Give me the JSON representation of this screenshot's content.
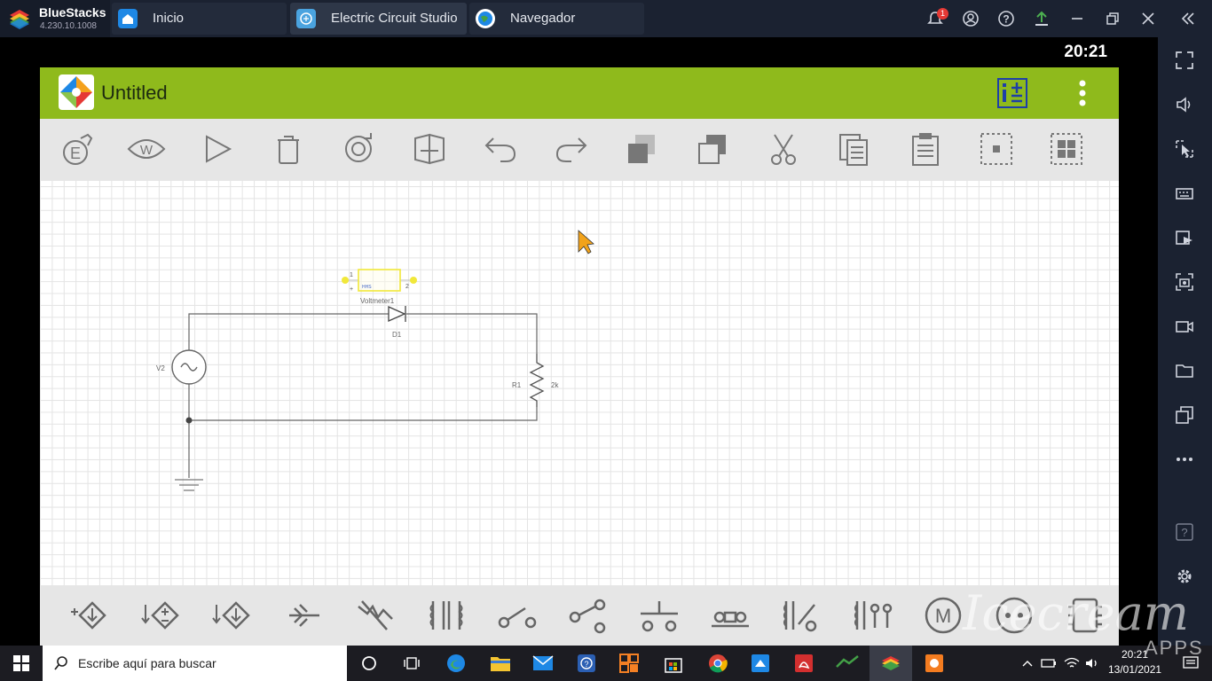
{
  "bluestacks": {
    "name": "BlueStacks",
    "version": "4.230.10.1008",
    "tabs": [
      {
        "label": "Inicio",
        "icon": "home-icon"
      },
      {
        "label": "Electric Circuit Studio",
        "icon": "circuit-app-icon"
      },
      {
        "label": "Navegador",
        "icon": "globe-icon"
      }
    ],
    "notification_count": "1",
    "top_icons": [
      "bell-icon",
      "account-icon",
      "help-icon",
      "upload-icon",
      "minimize-icon",
      "restore-icon",
      "close-icon",
      "collapse-sidebar-icon"
    ],
    "sidebar_icons": [
      "fullscreen-icon",
      "volume-icon",
      "pointer-icon",
      "keyboard-icon",
      "media-icon",
      "screenshot-icon",
      "record-icon",
      "folder-icon",
      "multi-instance-icon",
      "more-icon",
      "help-icon",
      "settings-icon"
    ]
  },
  "android": {
    "clock": "20:21"
  },
  "app": {
    "title": "Untitled",
    "actions": [
      "add-info-icon",
      "overflow-menu-icon"
    ],
    "toolbar": [
      "edit-settings-icon",
      "watch-icon",
      "run-icon",
      "delete-icon",
      "rotate-icon",
      "flip-icon",
      "undo-icon",
      "redo-icon",
      "copy-icon",
      "duplicate-icon",
      "cut-icon",
      "paste-icon",
      "clipboard-icon",
      "select-one-icon",
      "select-all-icon"
    ],
    "palette": [
      "voltage-source-icon",
      "dependent-source-icon",
      "current-source-icon",
      "zener-icon",
      "varistor-icon",
      "transformer-icon",
      "switch-spst-icon",
      "switch-spdt-icon",
      "pushbutton-icon",
      "relay-icon",
      "relay-switch-icon",
      "relay-switch-2-icon",
      "motor-icon",
      "meter-icon",
      "chip-icon"
    ]
  },
  "circuit": {
    "voltmeter_label": "Voltmeter1",
    "voltmeter_pin1": "1",
    "voltmeter_pin2": "2",
    "voltmeter_plus": "+",
    "voltmeter_value": "HHS",
    "diode_label": "D1",
    "source_label": "V2",
    "resistor_label": "R1",
    "resistor_value": "2k"
  },
  "taskbar": {
    "search_placeholder": "Escribe aquí para buscar",
    "time": "20:21",
    "date": "13/01/2021",
    "apps": [
      "task-view-icon",
      "edge-icon",
      "file-explorer-icon",
      "mail-icon",
      "help-app-icon",
      "office-icon",
      "store-icon",
      "chrome-icon",
      "paint-icon",
      "acrobat-icon",
      "gaming-icon",
      "bluestacks-icon",
      "icecream-icon"
    ]
  },
  "watermark": {
    "brand": "Icecream",
    "sub": "APPS"
  },
  "colors": {
    "app_bar": "#8fba1c",
    "toolbar_bg": "#e6e6e6",
    "bluestacks_bar": "#1b2231",
    "selection": "#f1e83a"
  }
}
